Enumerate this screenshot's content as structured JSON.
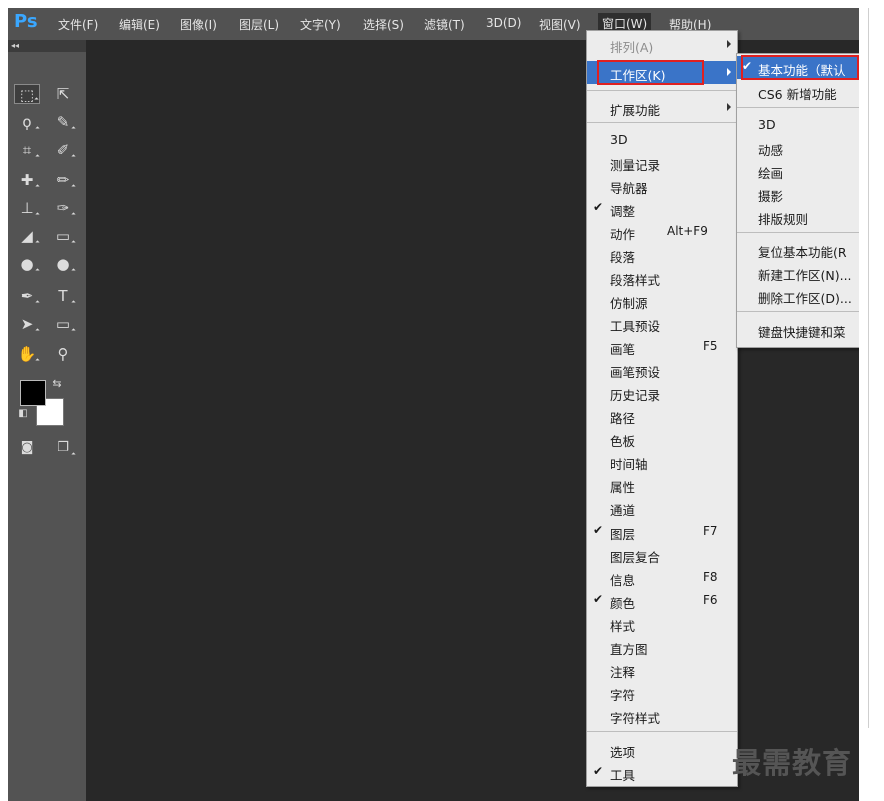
{
  "app": {
    "logo": "Ps"
  },
  "menubar": {
    "items": [
      "文件(F)",
      "编辑(E)",
      "图像(I)",
      "图层(L)",
      "文字(Y)",
      "选择(S)",
      "滤镜(T)",
      "3D(D)",
      "视图(V)",
      "窗口(W)",
      "帮助(H)"
    ],
    "active": "窗口(W)"
  },
  "toolbox": {
    "collapse_label": "◂◂",
    "tools": [
      "rectangular-marquee",
      "move",
      "lasso",
      "quick-selection",
      "crop",
      "eyedropper",
      "spot-healing",
      "brush",
      "clone-stamp",
      "history-brush",
      "eraser",
      "gradient",
      "blur",
      "dodge",
      "pen",
      "type",
      "path-selection",
      "rectangle",
      "hand",
      "zoom"
    ],
    "foreground_color": "#000000",
    "background_color": "#ffffff"
  },
  "window_menu": {
    "items": [
      {
        "label": "排列(A)",
        "disabled": true,
        "submenu": true
      },
      {
        "label": "工作区(K)",
        "highlighted": true,
        "submenu": true
      },
      {
        "label": "扩展功能",
        "submenu": true
      },
      {
        "label": "3D"
      },
      {
        "label": "测量记录"
      },
      {
        "label": "导航器"
      },
      {
        "label": "调整",
        "checked": true
      },
      {
        "label": "动作",
        "shortcut": "Alt+F9"
      },
      {
        "label": "段落"
      },
      {
        "label": "段落样式"
      },
      {
        "label": "仿制源"
      },
      {
        "label": "工具预设"
      },
      {
        "label": "画笔",
        "shortcut": "F5"
      },
      {
        "label": "画笔预设"
      },
      {
        "label": "历史记录"
      },
      {
        "label": "路径"
      },
      {
        "label": "色板"
      },
      {
        "label": "时间轴"
      },
      {
        "label": "属性"
      },
      {
        "label": "通道"
      },
      {
        "label": "图层",
        "checked": true,
        "shortcut": "F7"
      },
      {
        "label": "图层复合"
      },
      {
        "label": "信息",
        "shortcut": "F8"
      },
      {
        "label": "颜色",
        "checked": true,
        "shortcut": "F6"
      },
      {
        "label": "样式"
      },
      {
        "label": "直方图"
      },
      {
        "label": "注释"
      },
      {
        "label": "字符"
      },
      {
        "label": "字符样式"
      },
      {
        "label": "选项"
      },
      {
        "label": "工具",
        "checked": true
      }
    ]
  },
  "workspace_submenu": {
    "items": [
      {
        "label": "基本功能（默认",
        "checked": true,
        "highlighted": true
      },
      {
        "label": "CS6 新增功能"
      },
      {
        "label": "3D"
      },
      {
        "label": "动感"
      },
      {
        "label": "绘画"
      },
      {
        "label": "摄影"
      },
      {
        "label": "排版规则"
      },
      {
        "label": "复位基本功能(R"
      },
      {
        "label": "新建工作区(N)..."
      },
      {
        "label": "删除工作区(D)..."
      },
      {
        "label": "键盘快捷键和菜"
      }
    ]
  },
  "watermark": "最需教育",
  "colors": {
    "highlight": "#3a74c8",
    "annotation": "#e02020",
    "ps_blue": "#3aa7ff"
  }
}
